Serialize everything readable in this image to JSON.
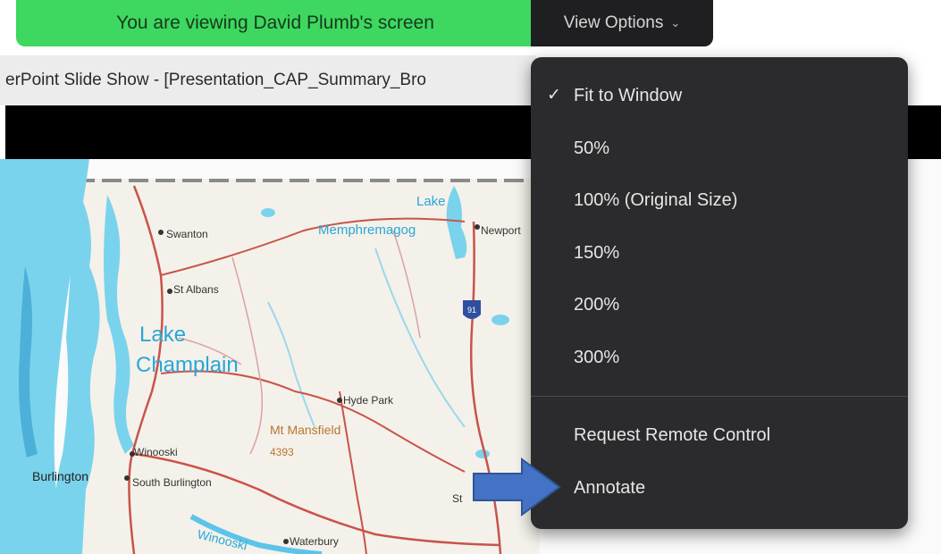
{
  "banner": {
    "text": "You are viewing David Plumb's screen"
  },
  "view_options": {
    "label": "View Options",
    "icon": "chevron-down-icon"
  },
  "window": {
    "title": "erPoint Slide Show - [Presentation_CAP_Summary_Bro"
  },
  "menu": {
    "items": [
      {
        "label": "Fit to Window",
        "checked": true,
        "check_glyph": "✓"
      },
      {
        "label": "50%"
      },
      {
        "label": "100% (Original Size)"
      },
      {
        "label": "150%"
      },
      {
        "label": "200%"
      },
      {
        "label": "300%"
      }
    ],
    "actions": [
      {
        "label": "Request Remote Control"
      },
      {
        "label": "Annotate"
      }
    ]
  },
  "map": {
    "labels": {
      "lake_top": "Lake",
      "lake_top_2": "Memphremagog",
      "lake_champlain_1": "Lake",
      "lake_champlain_2": "Champlain",
      "swanton": "Swanton",
      "st_albans": "St Albans",
      "newport": "Newport",
      "hyde_park": "Hyde Park",
      "mt_mansfield": "Mt Mansfield",
      "mt_mansfield_elev": "4393",
      "winooski": "Winooski",
      "burlington": "Burlington",
      "south_burlington": "South Burlington",
      "waterbury": "Waterbury",
      "winooski_river": "Winooski",
      "stowe": "St",
      "interstate": "91"
    }
  },
  "colors": {
    "banner": "#3ed760",
    "menu_bg": "#2b2b2d",
    "arrow": "#4472c4",
    "water": "#7ad3ec"
  }
}
